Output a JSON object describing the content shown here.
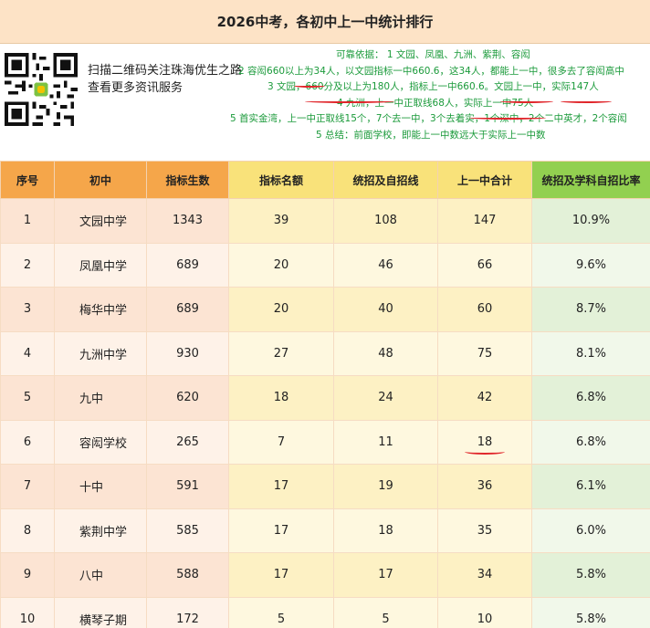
{
  "title": "2026中考，各初中上一中统计排行",
  "qr_caption": [
    "扫描二维码关注珠海优生之路",
    "查看更多资讯服务"
  ],
  "notes": [
    "可靠依据： 1 文园、凤凰、九洲、紫荆、容闳",
    "2 容闳660以上为34人，以文园指标一中660.6，这34人，都能上一中，很多去了容闳高中",
    "3 文园，660分及以上为180人，指标上一中660.6。文园上一中，实际147人",
    "4 九洲，上一中正取线68人，实际上一中75人",
    "5 首实金湾，上一中正取线15个，7个去一中，3个去着实，1个深中，2个二中英才，2个容闳",
    "5  总结：前面学校，即能上一中数远大于实际上一中数"
  ],
  "table": {
    "headers": [
      "序号",
      "初中",
      "指标生数",
      "指标名额",
      "统招及自招线",
      "上一中合计",
      "统招及学科自招比率"
    ],
    "rows": [
      [
        "1",
        "文园中学",
        "1343",
        "39",
        "108",
        "147",
        "10.9%"
      ],
      [
        "2",
        "凤凰中学",
        "689",
        "20",
        "46",
        "66",
        "9.6%"
      ],
      [
        "3",
        "梅华中学",
        "689",
        "20",
        "40",
        "60",
        "8.7%"
      ],
      [
        "4",
        "九洲中学",
        "930",
        "27",
        "48",
        "75",
        "8.1%"
      ],
      [
        "5",
        "九中",
        "620",
        "18",
        "24",
        "42",
        "6.8%"
      ],
      [
        "6",
        "容闳学校",
        "265",
        "7",
        "11",
        "18",
        "6.8%"
      ],
      [
        "7",
        "十中",
        "591",
        "17",
        "19",
        "36",
        "6.1%"
      ],
      [
        "8",
        "紫荆中学",
        "585",
        "17",
        "18",
        "35",
        "6.0%"
      ],
      [
        "9",
        "八中",
        "588",
        "17",
        "17",
        "34",
        "5.8%"
      ],
      [
        "10",
        "横琴子期",
        "172",
        "5",
        "5",
        "10",
        "5.8%"
      ]
    ]
  },
  "colors": {
    "orange_header": "#f5a64a",
    "yellow_header": "#f9e27a",
    "green_header": "#92d050",
    "note_text": "#1a9a3a",
    "annotation_red": "#e0262b"
  }
}
